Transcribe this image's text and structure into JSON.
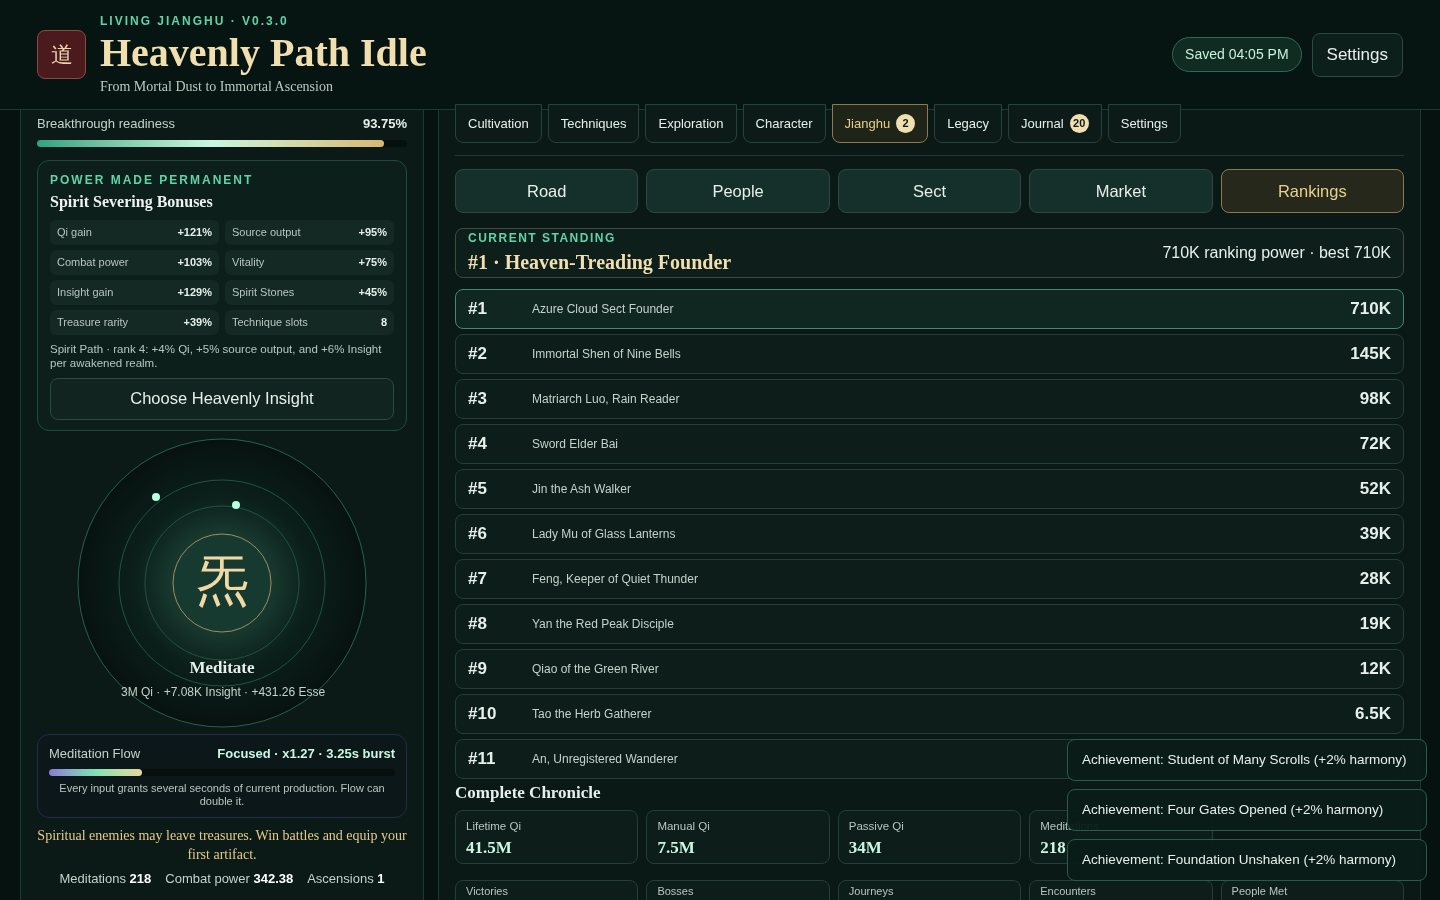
{
  "header": {
    "tag": "LIVING JIANGHU · V0.3.0",
    "logo": "道",
    "title": "Heavenly Path Idle",
    "subtitle": "From Mortal Dust to Immortal Ascension",
    "saved": "Saved 04:05 PM",
    "settings": "Settings"
  },
  "readiness": {
    "label": "Breakthrough readiness",
    "value": "93.75%",
    "level": 0.9375
  },
  "bonuses": {
    "eyebrow": "POWER MADE PERMANENT",
    "title": "Spirit Severing Bonuses",
    "items": [
      {
        "label": "Qi gain",
        "value": "+121%"
      },
      {
        "label": "Source output",
        "value": "+95%"
      },
      {
        "label": "Combat power",
        "value": "+103%"
      },
      {
        "label": "Vitality",
        "value": "+75%"
      },
      {
        "label": "Insight gain",
        "value": "+129%"
      },
      {
        "label": "Spirit Stones",
        "value": "+45%"
      },
      {
        "label": "Treasure rarity",
        "value": "+39%"
      },
      {
        "label": "Technique slots",
        "value": "8"
      }
    ],
    "note": "Spirit Path · rank 4: +4% Qi, +5% source output, and +6% Insight per awakened realm.",
    "button": "Choose Heavenly Insight"
  },
  "meditate": {
    "glyph": "炁",
    "label": "Meditate",
    "yield": "3M Qi · +7.08K Insight · +431.26 Esse"
  },
  "flow": {
    "label": "Meditation Flow",
    "status": "Focused · x1.27 · 3.25s burst",
    "level": 0.27,
    "note": "Every input grants several seconds of current production. Flow can double it."
  },
  "hint": "Spiritual enemies may leave treasures. Win battles and equip your first artifact.",
  "footer_stats": [
    {
      "label": "Meditations",
      "value": "218"
    },
    {
      "label": "Combat power",
      "value": "342.38"
    },
    {
      "label": "Ascensions",
      "value": "1"
    }
  ],
  "tabs": [
    {
      "label": "Cultivation",
      "selected": false
    },
    {
      "label": "Techniques",
      "selected": false
    },
    {
      "label": "Exploration",
      "selected": false
    },
    {
      "label": "Character",
      "selected": false
    },
    {
      "label": "Jianghu",
      "badge": "2",
      "selected": true
    },
    {
      "label": "Legacy",
      "selected": false
    },
    {
      "label": "Journal",
      "badge": "20",
      "selected": false
    },
    {
      "label": "Settings",
      "selected": false
    }
  ],
  "subtabs": [
    {
      "label": "Road",
      "selected": false
    },
    {
      "label": "People",
      "selected": false
    },
    {
      "label": "Sect",
      "selected": false
    },
    {
      "label": "Market",
      "selected": false
    },
    {
      "label": "Rankings",
      "selected": true
    }
  ],
  "standing": {
    "eyebrow": "CURRENT STANDING",
    "title": "#1 · Heaven-Treading Founder",
    "power": "710K ranking power · best 710K"
  },
  "rankings": [
    {
      "rank": "#1",
      "name": "Azure Cloud Sect Founder",
      "power": "710K",
      "selected": true
    },
    {
      "rank": "#2",
      "name": "Immortal Shen of Nine Bells",
      "power": "145K",
      "selected": false
    },
    {
      "rank": "#3",
      "name": "Matriarch Luo, Rain Reader",
      "power": "98K",
      "selected": false
    },
    {
      "rank": "#4",
      "name": "Sword Elder Bai",
      "power": "72K",
      "selected": false
    },
    {
      "rank": "#5",
      "name": "Jin the Ash Walker",
      "power": "52K",
      "selected": false
    },
    {
      "rank": "#6",
      "name": "Lady Mu of Glass Lanterns",
      "power": "39K",
      "selected": false
    },
    {
      "rank": "#7",
      "name": "Feng, Keeper of Quiet Thunder",
      "power": "28K",
      "selected": false
    },
    {
      "rank": "#8",
      "name": "Yan the Red Peak Disciple",
      "power": "19K",
      "selected": false
    },
    {
      "rank": "#9",
      "name": "Qiao of the Green River",
      "power": "12K",
      "selected": false
    },
    {
      "rank": "#10",
      "name": "Tao the Herb Gatherer",
      "power": "6.5K",
      "selected": false
    },
    {
      "rank": "#11",
      "name": "An, Unregistered Wanderer",
      "selected": false
    }
  ],
  "chronicle": {
    "title": "Complete Chronicle",
    "stats": [
      {
        "label": "Lifetime Qi",
        "value": "41.5M"
      },
      {
        "label": "Manual Qi",
        "value": "7.5M"
      },
      {
        "label": "Passive Qi",
        "value": "34M"
      },
      {
        "label": "Meditations",
        "value": "218"
      }
    ],
    "stats_row_2": [
      "Victories",
      "Bosses",
      "Journeys",
      "Encounters",
      "People Met"
    ]
  },
  "toasts": [
    "Achievement: Student of Many Scrolls (+2% harmony)",
    "Achievement: Four Gates Opened (+2% harmony)",
    "Achievement: Foundation Unshaken (+2% harmony)"
  ]
}
